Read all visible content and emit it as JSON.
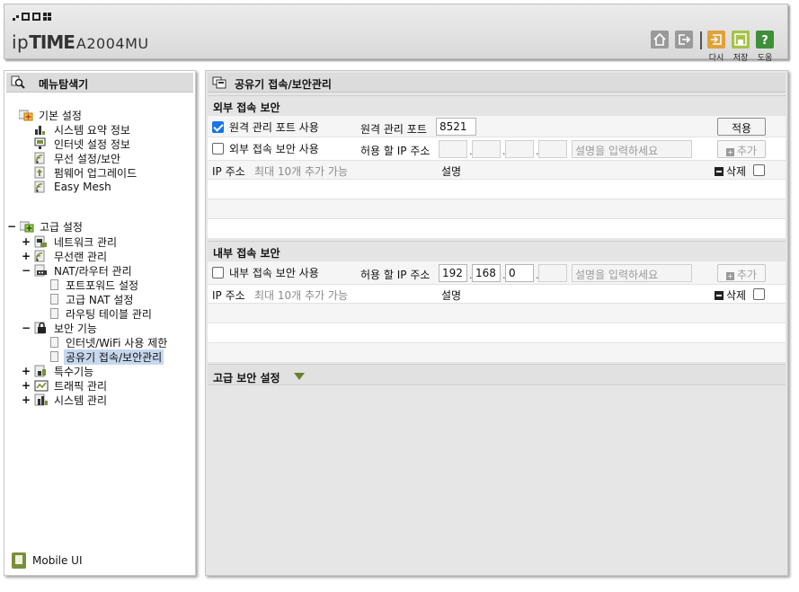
{
  "header": {
    "brand_ip": "ip",
    "brand_time": "TIME",
    "model": "A2004MU",
    "buttons": {
      "home_label": "",
      "logout_label": "",
      "undo_label": "다시",
      "save_label": "저장",
      "help_label": "도움"
    }
  },
  "sidebar": {
    "title": "메뉴탐색기",
    "basic": {
      "label": "기본 설정",
      "items": [
        "시스템 요약 정보",
        "인터넷 설정 정보",
        "무선 설정/보안",
        "펌웨어 업그레이드",
        "Easy Mesh"
      ]
    },
    "advanced": {
      "label": "고급 설정",
      "items": {
        "network": "네트워크 관리",
        "wireless": "무선랜 관리",
        "nat": "NAT/라우터 관리",
        "nat_children": [
          "포트포워드 설정",
          "고급 NAT 설정",
          "라우팅 테이블 관리"
        ],
        "security": "보안 기능",
        "security_children": [
          "인터넷/WiFi 사용 제한",
          "공유기 접속/보안관리"
        ],
        "special": "특수기능",
        "traffic": "트래픽 관리",
        "system": "시스템 관리"
      }
    },
    "mobile_ui": "Mobile UI"
  },
  "main": {
    "title": "공유기 접속/보안관리",
    "external": {
      "section_title": "외부 접속 보안",
      "remote_mgmt_label": "원격 관리 포트 사용",
      "remote_mgmt_checked": true,
      "remote_port_label": "원격 관리 포트",
      "remote_port_value": "8521",
      "apply_label": "적용",
      "ext_security_label": "외부 접속 보안 사용",
      "ext_security_checked": false,
      "allow_ip_label": "허용 할 IP 주소",
      "ip_values": [
        "",
        "",
        "",
        ""
      ],
      "desc_placeholder": "설명을 입력하세요",
      "add_label": "추가",
      "list_ip_header": "IP 주소",
      "list_ip_hint": "최대 10개 추가 가능",
      "list_desc_header": "설명",
      "delete_label": "삭제"
    },
    "internal": {
      "section_title": "내부 접속 보안",
      "int_security_label": "내부 접속 보안 사용",
      "int_security_checked": false,
      "allow_ip_label": "허용 할 IP 주소",
      "ip_values": [
        "192",
        "168",
        "0",
        ""
      ],
      "desc_placeholder": "설명을 입력하세요",
      "add_label": "추가",
      "list_ip_header": "IP 주소",
      "list_ip_hint": "최대 10개 추가 가능",
      "list_desc_header": "설명",
      "delete_label": "삭제"
    },
    "advanced_security": {
      "title": "고급 보안 설정"
    }
  },
  "colors": {
    "accent_green": "#7a8f3b",
    "checkbox_blue": "#1a73e8",
    "selected_bg": "#c7d8ee",
    "panel_bg": "#e6e6e6",
    "undo_orange": "#e0a23a",
    "save_green": "#a6c24a",
    "help_green": "#3f8f3a"
  }
}
